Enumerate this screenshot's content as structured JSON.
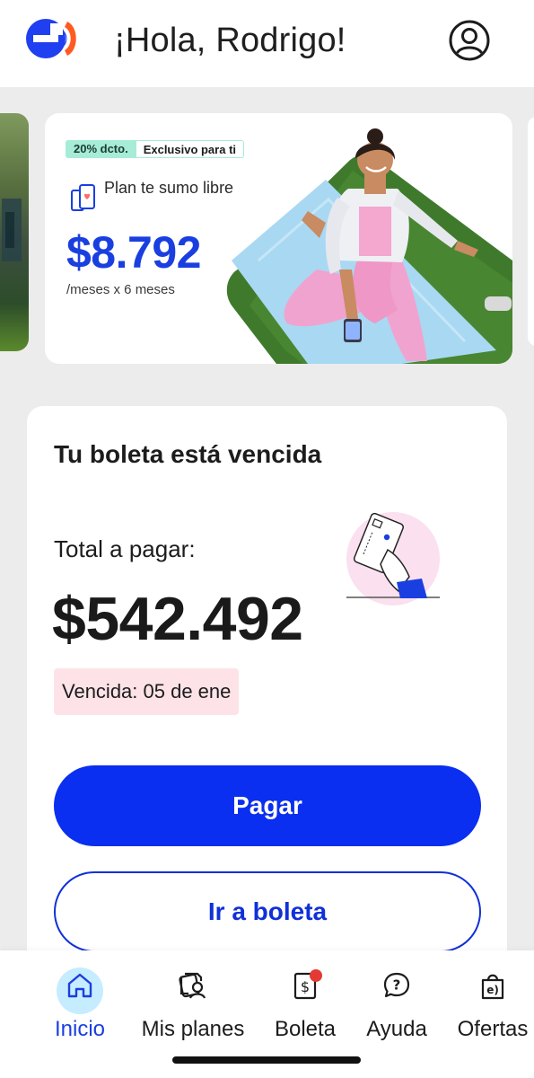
{
  "header": {
    "greeting": "¡Hola, Rodrigo!",
    "logo_icon": "entel-logo-icon",
    "profile_icon": "user-circle-icon"
  },
  "promo": {
    "tag_discount": "20% dcto.",
    "tag_exclusive": "Exclusivo para ti",
    "plan_name": "Plan te sumo libre",
    "price": "$8.792",
    "period": "/meses x 6 meses"
  },
  "bill": {
    "title": "Tu boleta está vencida",
    "total_label": "Total a pagar:",
    "total_amount": "$542.492",
    "due_label": "Vencida: 05 de ene",
    "pay_button": "Pagar",
    "bill_button": "Ir a boleta"
  },
  "nav": {
    "items": [
      {
        "label": "Inicio",
        "icon": "home-icon"
      },
      {
        "label": "Mis planes",
        "icon": "plans-user-icon"
      },
      {
        "label": "Boleta",
        "icon": "bill-dollar-icon"
      },
      {
        "label": "Ayuda",
        "icon": "help-question-icon"
      },
      {
        "label": "Ofertas",
        "icon": "shopping-bag-icon"
      }
    ]
  },
  "colors": {
    "brand_blue": "#0a2ff0",
    "brand_orange": "#ff5a1f",
    "promo_price": "#1a3fe0",
    "due_badge_bg": "#fde3e7",
    "notification": "#e53935",
    "active_tab": "#1a3fe0"
  }
}
